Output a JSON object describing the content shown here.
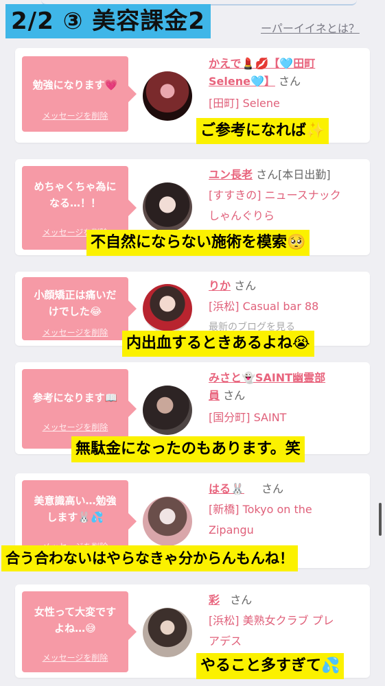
{
  "header": {
    "banner": "2/2 ③ 美容課金2",
    "link_text": "ーパーイイネとは？"
  },
  "cards": [
    {
      "message": "勉強になります💗",
      "delete_label": "メッセージを削除",
      "name_line1": "かえで💄💋【🩵田町",
      "name_line2": "Selene🩵】",
      "san": "さん",
      "shop_line1": "[田町] Selene",
      "shop_line2": "",
      "caption": "ご参考になれば✨"
    },
    {
      "message_line1": "めちゃくちゃ為に",
      "message_line2": "なる…！！",
      "delete_label": "メッセージを削除",
      "name_line1": "ユン長老",
      "san": "さん[本日出勤]",
      "shop_line1": "[すすきの] ニュースナック",
      "shop_line2": "しゃんぐりら",
      "caption": "不自然にならない施術を模索🥺"
    },
    {
      "message_line1": "小顔矯正は痛いだ",
      "message_line2": "けでした😂",
      "delete_label": "メッセージを削除",
      "name_line1": "りか",
      "san": "さん",
      "shop_line1": "[浜松] Casual bar 88",
      "shop_line2": "最新のブログを見る",
      "caption": "内出血するときあるよね😭"
    },
    {
      "message": "参考になります📖",
      "delete_label": "メッセージを削除",
      "name_line1": "みさと👻SAINT幽霊部",
      "name_line2": "員",
      "san": "さん",
      "shop_line1": "[国分町] SAINT",
      "shop_line2": "",
      "caption": "無駄金になったのもあります。笑"
    },
    {
      "message_line1": "美意識高い…勉強",
      "message_line2": "します🐰💦",
      "delete_label": "メッセージを削除",
      "name_line1": "はる🐰",
      "san": "さん",
      "shop_line1": "[新橋] Tokyo on the",
      "shop_line2": "Zipangu",
      "caption": "合う合わないはやらなきゃ分からんもんね！"
    },
    {
      "message_line1": "女性って大変です",
      "message_line2": "よね…😅",
      "delete_label": "メッセージを削除",
      "name_line1": "彩",
      "san": "さん",
      "shop_line1": "[浜松] 美熟女クラブ プレ",
      "shop_line2": "アデス",
      "caption": "やること多すぎて💦"
    }
  ],
  "colors": {
    "banner": "#3fb6e8",
    "bubble": "#f69aa6",
    "name_link": "#e8647d",
    "caption_bg": "#fbf100"
  }
}
